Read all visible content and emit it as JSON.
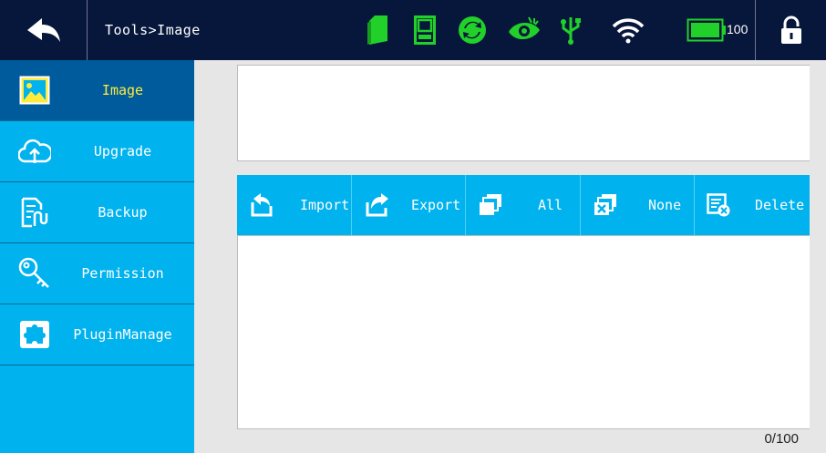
{
  "header": {
    "breadcrumb": "Tools>Image",
    "battery_level": "100",
    "status_icons": [
      "sd-card-icon",
      "device-icon",
      "sync-icon",
      "eye-icon",
      "usb-icon",
      "wifi-icon",
      "battery-icon"
    ]
  },
  "colors": {
    "header_bg": "#07163b",
    "status_green": "#22d02a",
    "sidebar_bg": "#00b2ee",
    "sidebar_active": "#005b9d",
    "active_label": "#ffeb3b"
  },
  "sidebar": {
    "items": [
      {
        "label": "Image",
        "icon": "image-icon",
        "active": true
      },
      {
        "label": "Upgrade",
        "icon": "cloud-upload-icon",
        "active": false
      },
      {
        "label": "Backup",
        "icon": "backup-file-icon",
        "active": false
      },
      {
        "label": "Permission",
        "icon": "key-icon",
        "active": false
      },
      {
        "label": "PluginManage",
        "icon": "puzzle-icon",
        "active": false
      }
    ]
  },
  "toolbar": {
    "import_label": "Import",
    "export_label": "Export",
    "all_label": "All",
    "none_label": "None",
    "delete_label": "Delete"
  },
  "list": {
    "counter": "0/100"
  }
}
